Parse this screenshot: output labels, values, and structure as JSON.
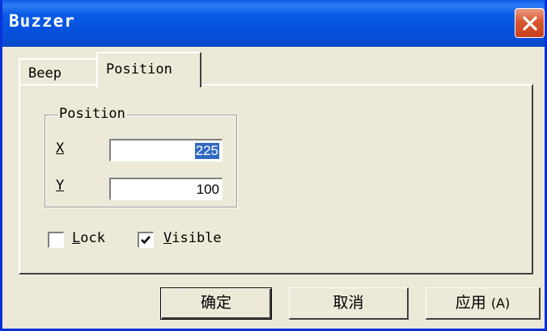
{
  "window": {
    "title": "Buzzer"
  },
  "tabs": [
    {
      "label": "Beep"
    },
    {
      "label": "Position"
    }
  ],
  "position_group": {
    "label": "Position",
    "x_label": "X",
    "x_value": "225",
    "y_label": "Y",
    "y_value": "100"
  },
  "checkboxes": {
    "lock": {
      "mnemonic": "L",
      "rest": "ock",
      "checked": false
    },
    "visible": {
      "mnemonic": "V",
      "rest": "isible",
      "checked": true
    }
  },
  "buttons": {
    "ok": "确定",
    "cancel": "取消",
    "apply_text": "应用",
    "apply_mnemonic": "(A)"
  },
  "colors": {
    "titlebar": "#0a5ee8",
    "close": "#d9572f",
    "face": "#ece9d8",
    "selection": "#316ac5"
  },
  "icons": {
    "close": "close-icon",
    "check": "check-icon"
  }
}
